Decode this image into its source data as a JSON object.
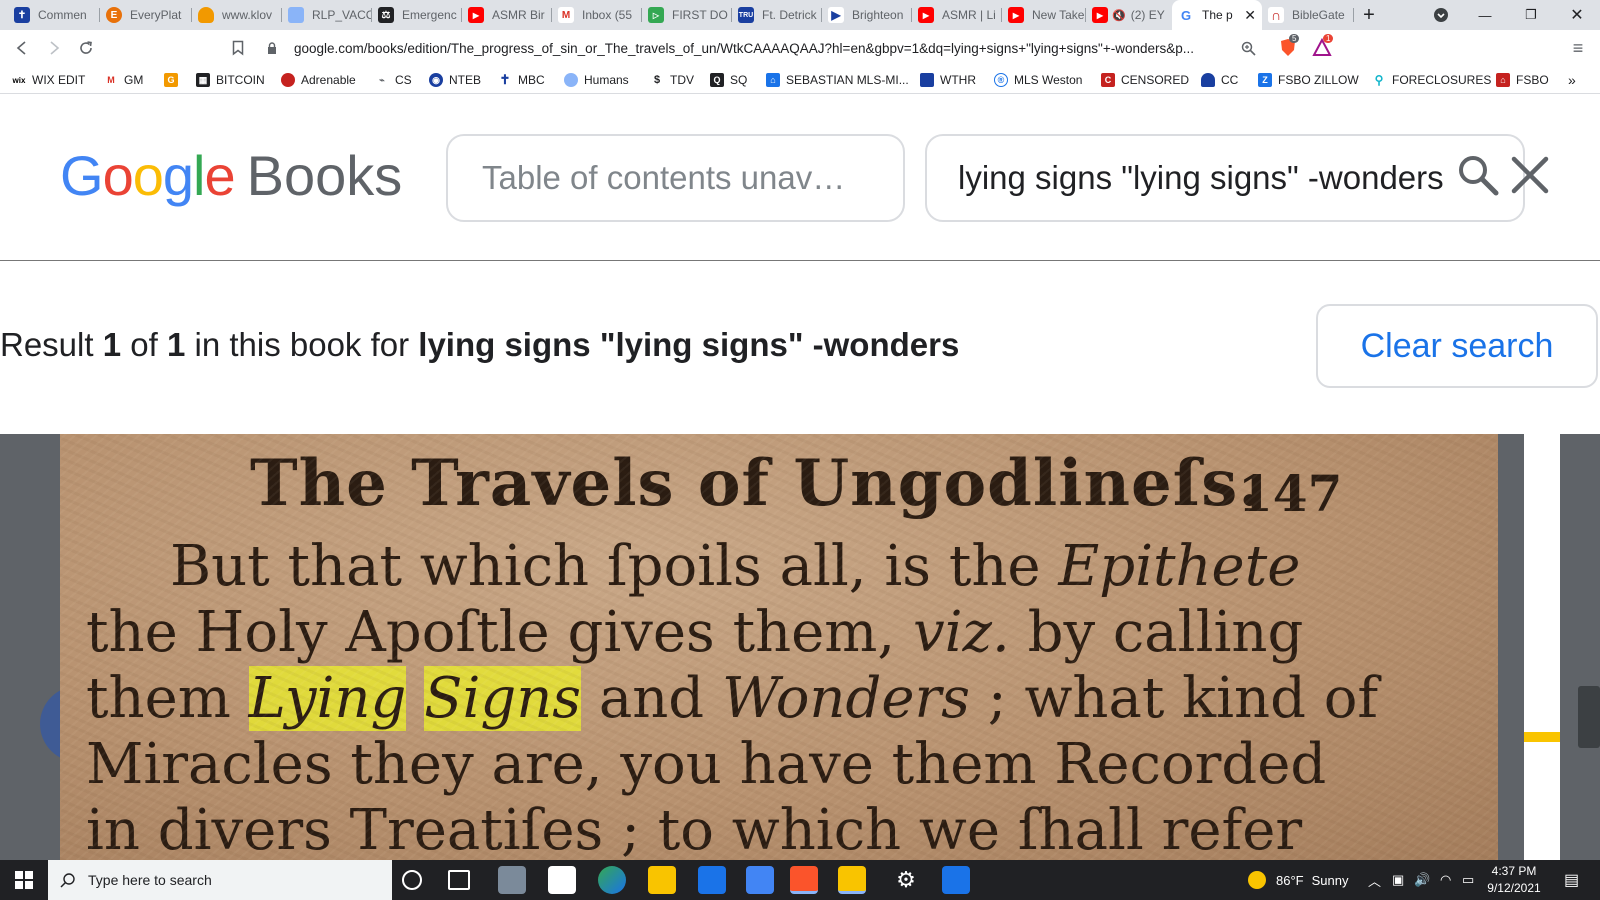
{
  "browser": {
    "tabs": [
      {
        "title": "Commen",
        "favicon": "cross-icon",
        "color": "#1a3fa0"
      },
      {
        "title": "EveryPlat",
        "favicon": "e-circle-icon",
        "color": "#e8710a"
      },
      {
        "title": "www.klov",
        "favicon": "cloud-icon",
        "color": "#f29900"
      },
      {
        "title": "RLP_VACC",
        "favicon": "document-icon",
        "color": "#4285f4"
      },
      {
        "title": "Emergenc",
        "favicon": "scales-icon",
        "color": "#202124"
      },
      {
        "title": "ASMR Bir",
        "favicon": "youtube-icon",
        "color": "#ff0000"
      },
      {
        "title": "Inbox (55",
        "favicon": "gmail-icon",
        "color": "#d93025"
      },
      {
        "title": "FIRST DO",
        "favicon": "play-icon",
        "color": "#34a853"
      },
      {
        "title": "Ft. Detrick",
        "favicon": "tru-icon",
        "color": "#1a3fa0"
      },
      {
        "title": "Brighteon",
        "favicon": "brighteon-icon",
        "color": "#1a3fa0"
      },
      {
        "title": "ASMR | Li",
        "favicon": "youtube-icon",
        "color": "#ff0000"
      },
      {
        "title": "New Take",
        "favicon": "youtube-icon",
        "color": "#ff0000"
      },
      {
        "title": "(2) EY",
        "favicon": "youtube-icon",
        "color": "#ff0000"
      },
      {
        "title": "The p",
        "favicon": "google-icon",
        "color": "#4285f4",
        "active": true
      },
      {
        "title": "BibleGate",
        "favicon": "biblegateway-icon",
        "color": "#c5221f"
      }
    ],
    "new_tab_label": "+",
    "url": "google.com/books/edition/The_progress_of_sin_or_The_travels_of_un/WtkCAAAAQAAJ?hl=en&gbpv=1&dq=lying+signs+\"lying+signs\"+-wonders&p...",
    "brave_badge": "5",
    "alert_badge": "1",
    "bookmarks": [
      {
        "label": "WIX EDIT",
        "icon": "wix-icon",
        "color": "#000000"
      },
      {
        "label": "GM",
        "icon": "gmail-icon",
        "color": "#d93025"
      },
      {
        "label": "",
        "icon": "folder-g-icon",
        "color": "#f29900"
      },
      {
        "label": "BITCOIN",
        "icon": "bitcoin-icon",
        "color": "#202124"
      },
      {
        "label": "Adrenable",
        "icon": "adrenable-icon",
        "color": "#c5221f"
      },
      {
        "label": "CS",
        "icon": "cs-icon",
        "color": "#5f6368"
      },
      {
        "label": "NTEB",
        "icon": "nteb-icon",
        "color": "#1a3fa0"
      },
      {
        "label": "MBC",
        "icon": "cross-icon",
        "color": "#1a3fa0"
      },
      {
        "label": "Humans",
        "icon": "globe-icon",
        "color": "#4285f4"
      },
      {
        "label": "TDV",
        "icon": "tdv-icon",
        "color": "#202124"
      },
      {
        "label": "SQ",
        "icon": "sq-icon",
        "color": "#202124"
      },
      {
        "label": "SEBASTIAN MLS-MI...",
        "icon": "mls-icon",
        "color": "#1a73e8"
      },
      {
        "label": "WTHR",
        "icon": "wthr-icon",
        "color": "#1a3fa0"
      },
      {
        "label": "MLS Weston",
        "icon": "mls-weston-icon",
        "color": "#1a73e8"
      },
      {
        "label": "CENSORED",
        "icon": "censored-icon",
        "color": "#c5221f"
      },
      {
        "label": "CC",
        "icon": "cc-icon",
        "color": "#1a3fa0"
      },
      {
        "label": "FSBO ZILLOW",
        "icon": "zillow-icon",
        "color": "#1a73e8"
      },
      {
        "label": "FORECLOSURES",
        "icon": "pin-icon",
        "color": "#12b5cb"
      },
      {
        "label": "FSBO",
        "icon": "house-icon",
        "color": "#c5221f"
      }
    ]
  },
  "books": {
    "logo": {
      "g1": "G",
      "o1": "o",
      "o2": "o",
      "g2": "g",
      "l": "l",
      "e": "e",
      "books": "Books"
    },
    "logo_colors": {
      "blue": "#4285f4",
      "red": "#ea4335",
      "yellow": "#fbbc05",
      "green": "#34a853"
    },
    "toc_placeholder": "Table of contents unav…",
    "search_query": "lying signs \"lying signs\" -wonders",
    "result": {
      "prefix": "Result",
      "current": "1",
      "of": "of",
      "total": "1",
      "middle": "in this book for",
      "query": "lying signs \"lying signs\" -wonders"
    },
    "clear_button": "Clear search",
    "accent": "#1a73e8"
  },
  "page": {
    "header": "The Travels of Ungodlineſs.",
    "number": "147",
    "lines": {
      "l1a": "But that which ſpoils all, is the ",
      "l1b": "Epithete",
      "l2a": "the Holy Apoſtle gives them, ",
      "l2b": "viz.",
      "l2c": " by calling",
      "l3a": "them ",
      "l3b": "Lying",
      "l3c": " ",
      "l3d": "Signs",
      "l3e": " and ",
      "l3f": "Wonders",
      "l3g": " ; what kind of",
      "l4": "Miracles they are, you have them Recorded",
      "l5": "in divers Treatiſes ; to which we ſhall refer"
    },
    "highlight_color": "#ecf028"
  },
  "taskbar": {
    "search_placeholder": "Type here to search",
    "weather_temp": "86°F",
    "weather_desc": "Sunny",
    "time": "4:37 PM",
    "date": "9/12/2021"
  }
}
